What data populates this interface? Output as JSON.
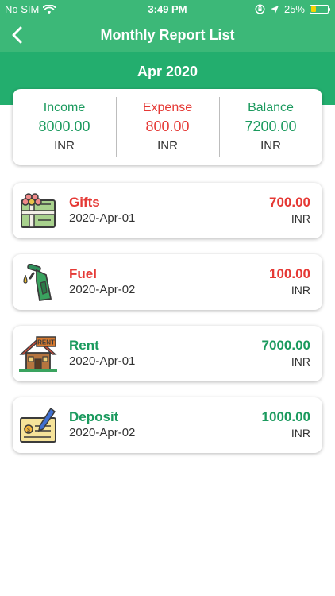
{
  "status_bar": {
    "carrier": "No SIM",
    "time": "3:49 PM",
    "battery": "25%",
    "battery_level": 0.25,
    "battery_color": "#f5d400",
    "icons": [
      "wifi-icon",
      "orientation-lock-icon",
      "location-arrow-icon",
      "battery-icon"
    ]
  },
  "nav": {
    "title": "Monthly Report List",
    "back_icon": "chevron-left-icon"
  },
  "month": "Apr 2020",
  "summary": {
    "income": {
      "label": "Income",
      "value": "8000.00",
      "unit": "INR"
    },
    "expense": {
      "label": "Expense",
      "value": "800.00",
      "unit": "INR"
    },
    "balance": {
      "label": "Balance",
      "value": "7200.00",
      "unit": "INR"
    }
  },
  "colors": {
    "header_green": "#3cb878",
    "band_green": "#23ae6e",
    "income_green": "#1b9a5e",
    "expense_red": "#e53935"
  },
  "entries": [
    {
      "title": "Gifts",
      "date": "2020-Apr-01",
      "amount": "700.00",
      "unit": "INR",
      "type": "expense",
      "icon": "gift-icon"
    },
    {
      "title": "Fuel",
      "date": "2020-Apr-02",
      "amount": "100.00",
      "unit": "INR",
      "type": "expense",
      "icon": "fuel-nozzle-icon"
    },
    {
      "title": "Rent",
      "date": "2020-Apr-01",
      "amount": "7000.00",
      "unit": "INR",
      "type": "income",
      "icon": "rent-house-icon",
      "icon_sign": "RENT"
    },
    {
      "title": "Deposit",
      "date": "2020-Apr-02",
      "amount": "1000.00",
      "unit": "INR",
      "type": "income",
      "icon": "cheque-icon"
    }
  ]
}
